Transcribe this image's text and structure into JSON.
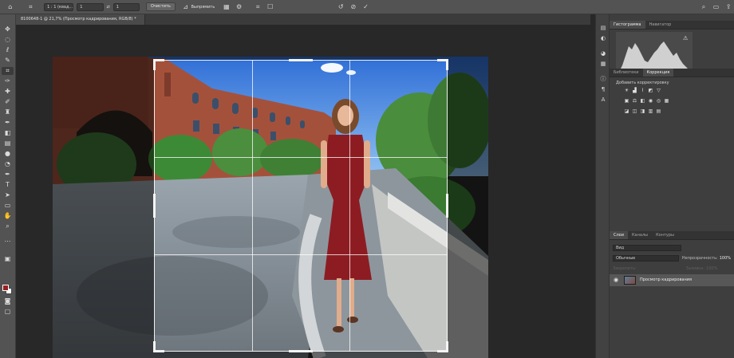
{
  "options_bar": {
    "ratio_preset": "1 : 1 (квад...",
    "width_value": "1",
    "height_value": "1",
    "swap_glyph": "⇄",
    "clear_label": "Очистить",
    "straighten_label": "Выпрямить",
    "icons": [
      "home-icon",
      "crop-tool-icon",
      "straighten-icon",
      "grid-overlay-icon",
      "settings-gear-icon",
      "content-aware-icon",
      "reset-icon",
      "cancel-icon",
      "commit-check-icon",
      "search-icon",
      "workspace-icon",
      "share-icon"
    ]
  },
  "document": {
    "tab_title": "8100648-1 @ 21,7% (Просмотр кадрирования, RGB/8) *"
  },
  "toolbar": {
    "tools": [
      "move",
      "marquee",
      "lasso",
      "quick-select",
      "crop",
      "eyedropper",
      "healing",
      "brush",
      "clone",
      "history-brush",
      "eraser",
      "gradient",
      "blur",
      "dodge",
      "pen",
      "type",
      "path-select",
      "shape",
      "hand",
      "zoom"
    ],
    "foreground_color": "#9a1e22",
    "background_color": "#ffffff"
  },
  "panels": {
    "histogram_tabs": [
      "Гистограмма",
      "Навигатор"
    ],
    "histogram_warning": "⚠",
    "adjustment_tabs": [
      "Библиотеки",
      "Коррекция"
    ],
    "adjustments_title": "Добавить корректировку",
    "layers_tabs": [
      "Слои",
      "Каналы",
      "Контуры"
    ],
    "layers_search_placeholder": "Вид",
    "blend_mode": "Обычные",
    "opacity_label": "Непрозрачность:",
    "opacity_value": "100%",
    "lock_label": "Закрепить:",
    "fill_label": "Заливка:",
    "fill_value": "100%",
    "layer_name": "Просмотр кадрирования"
  },
  "crop": {
    "grid": "rule-of-thirds"
  }
}
